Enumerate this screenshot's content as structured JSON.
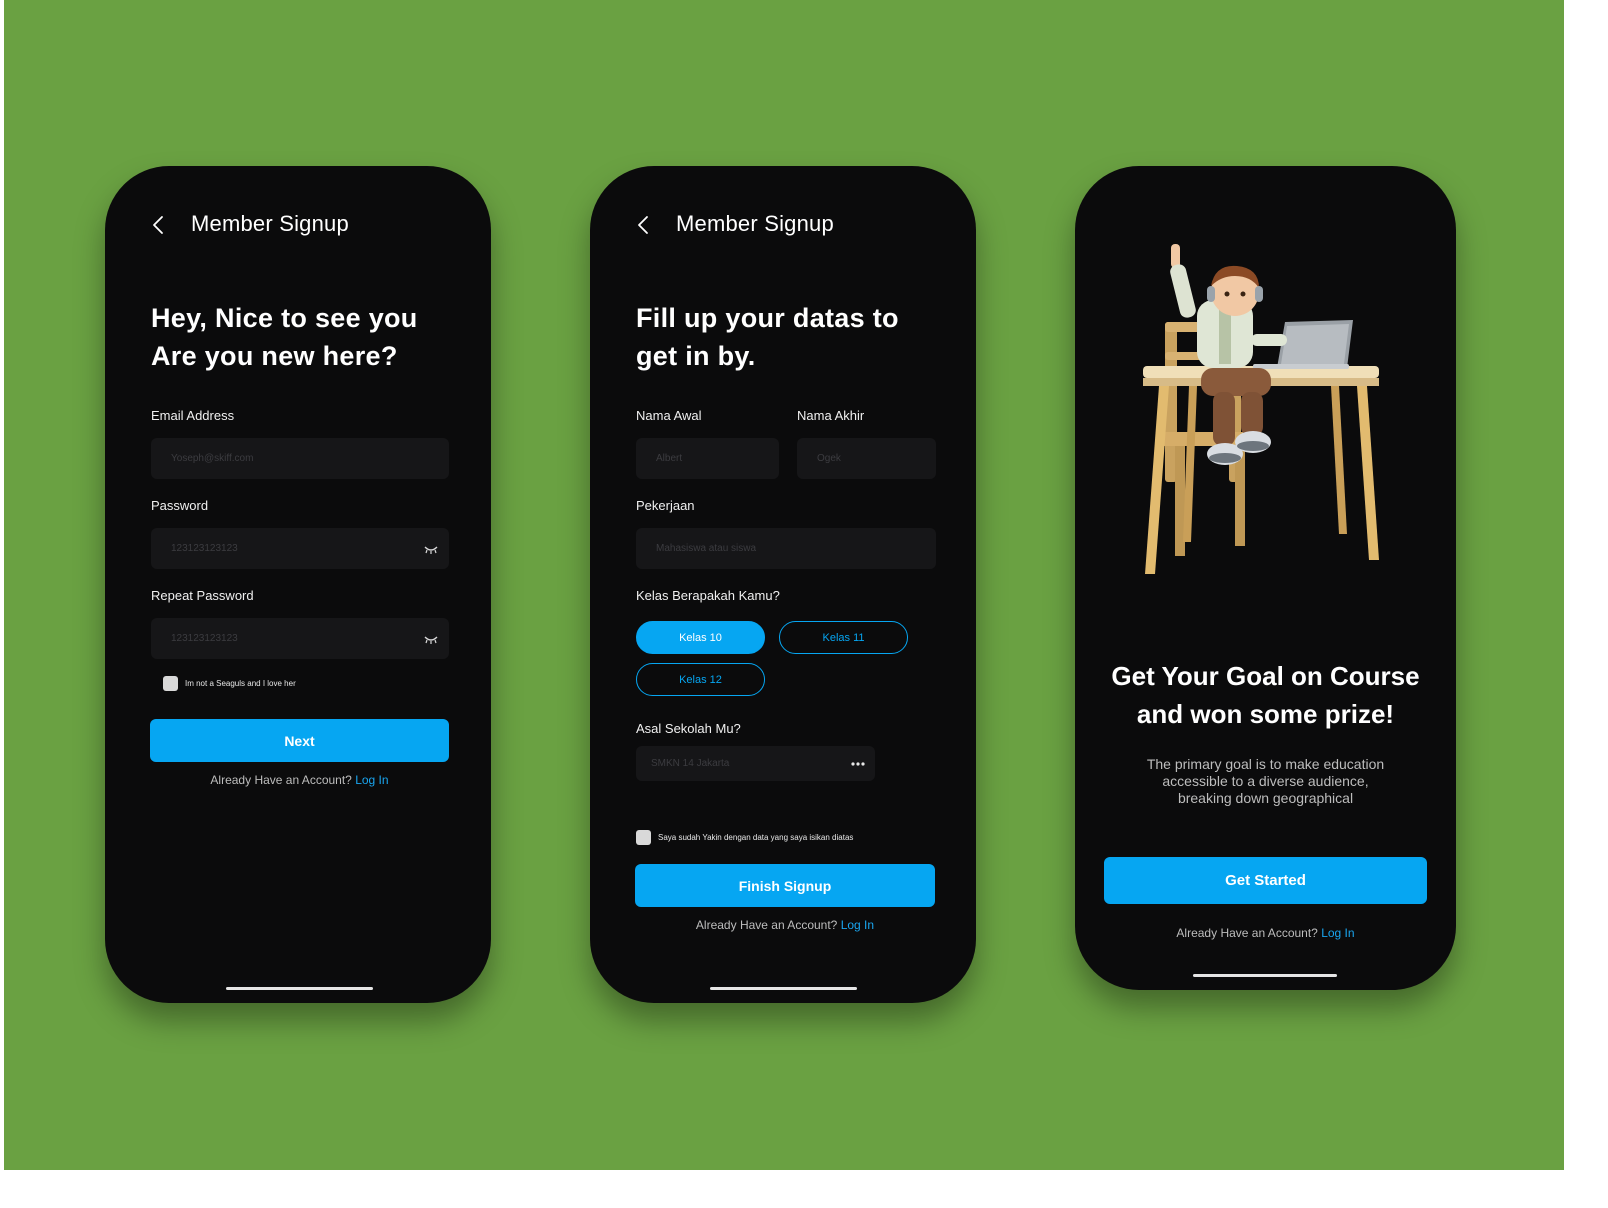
{
  "colors": {
    "background": "#6aa142",
    "phone": "#0b0b0c",
    "accent": "#06a6f2",
    "input_bg": "#161618"
  },
  "screen1": {
    "header_title": "Member Signup",
    "heading_line1": "Hey, Nice to see you",
    "heading_line2": "Are you new here?",
    "email_label": "Email Address",
    "email_placeholder": "Yoseph@skiff.com",
    "password_label": "Password",
    "password_value": "123123123123",
    "repeat_password_label": "Repeat Password",
    "repeat_password_value": "123123123123",
    "checkbox_label": "Im not a Seaguls and I love her",
    "next_button": "Next",
    "login_prompt": "Already Have an Account?",
    "login_link": "Log In"
  },
  "screen2": {
    "header_title": "Member Signup",
    "heading_line1": "Fill up your datas to",
    "heading_line2": "get in by.",
    "first_name_label": "Nama Awal",
    "first_name_placeholder": "Albert",
    "last_name_label": "Nama Akhir",
    "last_name_placeholder": "Ogek",
    "job_label": "Pekerjaan",
    "job_placeholder": "Mahasiswa atau siswa",
    "class_label": "Kelas Berapakah Kamu?",
    "class_options": [
      "Kelas 10",
      "Kelas 11",
      "Kelas 12"
    ],
    "class_selected": "Kelas 10",
    "school_label": "Asal Sekolah Mu?",
    "school_placeholder": "SMKN 14 Jakarta",
    "checkbox_label": "Saya sudah Yakin dengan data yang saya isikan diatas",
    "finish_button": "Finish Signup",
    "login_prompt": "Already Have an Account?",
    "login_link": "Log In"
  },
  "screen3": {
    "illustration": "student-at-desk-with-laptop",
    "title_line1": "Get Your Goal on Course",
    "title_line2": "and won some prize!",
    "desc_line1": "The primary goal is to make education",
    "desc_line2": "accessible to a diverse audience,",
    "desc_line3": "breaking down geographical",
    "get_started_button": "Get Started",
    "login_prompt": "Already Have an Account?",
    "login_link": "Log In"
  },
  "icons": {
    "back": "chevron-left-icon",
    "password_toggle": "eye-closed-icon",
    "more": "more-horizontal-icon"
  }
}
